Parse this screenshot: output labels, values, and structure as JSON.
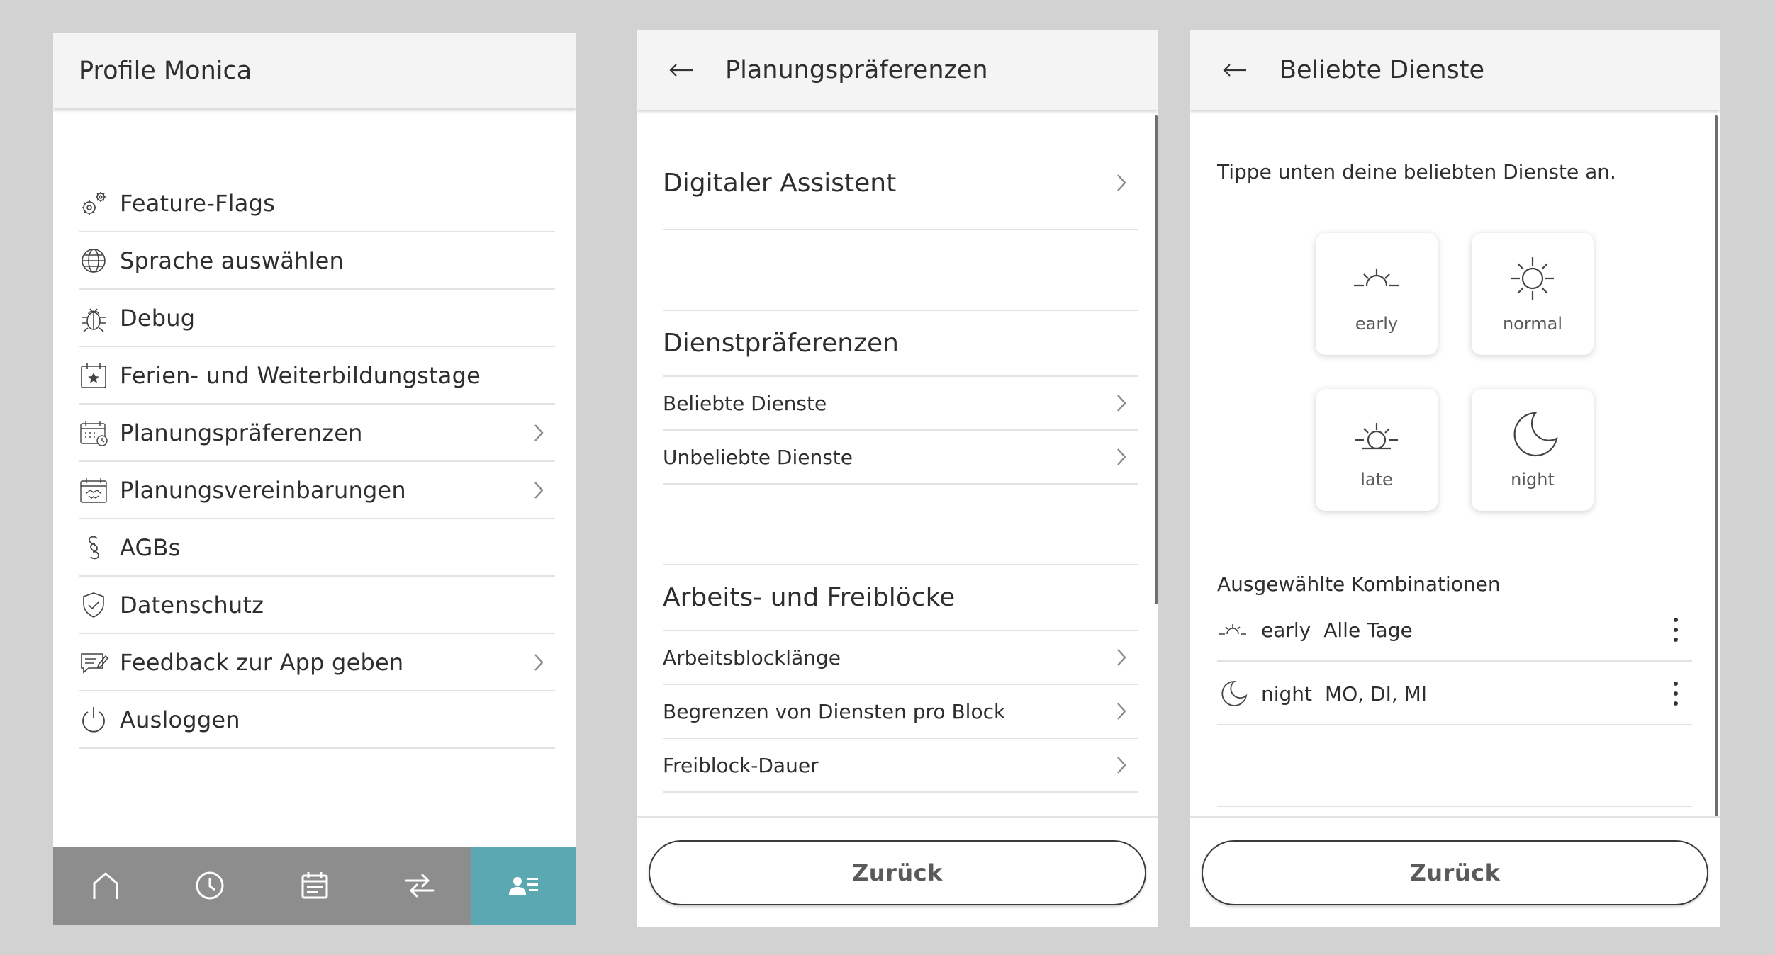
{
  "profile": {
    "title": "Profile Monica",
    "menu": [
      {
        "label": "Feature-Flags",
        "icon": "gears-icon",
        "chevron": false
      },
      {
        "label": "Sprache auswählen",
        "icon": "globe-icon",
        "chevron": false
      },
      {
        "label": "Debug",
        "icon": "bug-icon",
        "chevron": false
      },
      {
        "label": "Ferien- und Weiterbildungstage",
        "icon": "calendar-star-icon",
        "chevron": false
      },
      {
        "label": "Planungspräferenzen",
        "icon": "calendar-clock-icon",
        "chevron": true
      },
      {
        "label": "Planungsvereinbarungen",
        "icon": "calendar-handshake-icon",
        "chevron": true
      },
      {
        "label": "AGBs",
        "icon": "paragraph-icon",
        "chevron": false
      },
      {
        "label": "Datenschutz",
        "icon": "shield-check-icon",
        "chevron": false
      },
      {
        "label": "Feedback zur App geben",
        "icon": "feedback-icon",
        "chevron": true
      },
      {
        "label": "Ausloggen",
        "icon": "power-icon",
        "chevron": false
      }
    ],
    "nav": [
      "home-icon",
      "clock-icon",
      "calendar-icon",
      "swap-icon",
      "profile-icon"
    ],
    "nav_active_color": "#5ba8b3"
  },
  "prefs": {
    "title": "Planungspräferenzen",
    "digital_assistant": "Digitaler Assistent",
    "section1": {
      "title": "Dienstpräferenzen",
      "rows": [
        "Beliebte Dienste",
        "Unbeliebte Dienste"
      ]
    },
    "section2": {
      "title": "Arbeits- und Freiblöcke",
      "rows": [
        "Arbeitsblocklänge",
        "Begrenzen von Diensten pro Block",
        "Freiblock-Dauer"
      ]
    },
    "back_button": "Zurück"
  },
  "fav": {
    "title": "Beliebte Dienste",
    "intro": "Tippe unten deine beliebten Dienste an.",
    "shifts": [
      {
        "label": "early",
        "icon": "sunrise-icon"
      },
      {
        "label": "normal",
        "icon": "sun-icon"
      },
      {
        "label": "late",
        "icon": "sunset-icon"
      },
      {
        "label": "night",
        "icon": "moon-icon"
      }
    ],
    "combos_title": "Ausgewählte Kombinationen",
    "combos": [
      {
        "shift": "early",
        "days": "Alle Tage",
        "icon": "sunrise-icon"
      },
      {
        "shift": "night",
        "days": "MO, DI, MI",
        "icon": "moon-icon"
      }
    ],
    "back_button": "Zurück"
  }
}
